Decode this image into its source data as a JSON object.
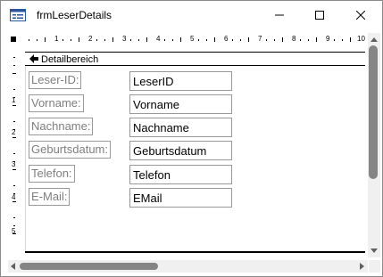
{
  "window": {
    "title": "frmLeserDetails"
  },
  "ruler": {
    "horizontal": [
      "1",
      "2",
      "3",
      "4",
      "5",
      "6",
      "7",
      "8",
      "9",
      "10"
    ],
    "vertical": [
      "1",
      "2",
      "3",
      "4",
      "5"
    ]
  },
  "section": {
    "label": "Detailbereich"
  },
  "fields": [
    {
      "label": "Leser-ID:",
      "value": "LeserID"
    },
    {
      "label": "Vorname:",
      "value": "Vorname"
    },
    {
      "label": "Nachname:",
      "value": "Nachname"
    },
    {
      "label": "Geburtsdatum:",
      "value": "Geburtsdatum"
    },
    {
      "label": "Telefon:",
      "value": "Telefon"
    },
    {
      "label": "E-Mail:",
      "value": "EMail"
    }
  ],
  "colors": {
    "label_text": "#7f7f7f",
    "border": "#999999",
    "scroll_thumb": "#858585",
    "scroll_track": "#f0f0f0"
  }
}
